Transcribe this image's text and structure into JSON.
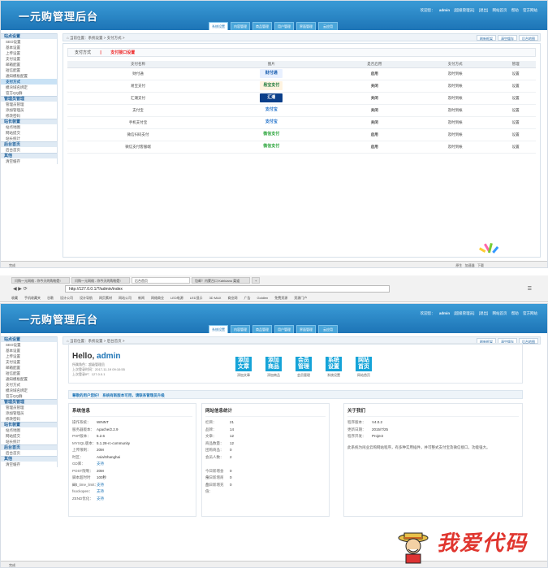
{
  "shot1": {
    "logo": "一元购管理后台",
    "topbar": [
      "欢迎您：",
      "admin",
      "[超级管理员]",
      "[退出]",
      "网站首页",
      "帮助",
      "官方网站"
    ],
    "tabs": [
      "系统设置",
      "内容管理",
      "商品管理",
      "用户管理",
      "界面管理",
      "云应用"
    ],
    "active_tab": "系统设置",
    "breadcrumb": "当前位置：系统设置 > 支付方式 >",
    "crumb_buttons": [
      "刷新框架",
      "清空缓存",
      "后台地图"
    ],
    "sidebar": [
      {
        "group": "站点设置",
        "items": [
          "SEO设置",
          "基本设置",
          "上传设置",
          "支付设置",
          "邮箱配置",
          "短信配置",
          "通知模板配置",
          "支付方式",
          "模块域名绑定",
          "官方QQ群"
        ]
      },
      {
        "group": "管理员管理",
        "items": [
          "管理员管理",
          "添加管理员",
          "修改密码"
        ]
      },
      {
        "group": "站长装置",
        "items": [
          "站点地图",
          "网站提交",
          "站长统计"
        ]
      },
      {
        "group": "后台首页",
        "items": [
          "后台首页"
        ]
      },
      {
        "group": "其他",
        "items": [
          "清空缓存"
        ]
      }
    ],
    "selected_sidebar": "支付方式",
    "panel_title": "支付方式",
    "panel_sub": "支付接口设置",
    "columns": [
      "支付名称",
      "图片",
      "是否启用",
      "支付方式",
      "管理"
    ],
    "rows": [
      {
        "name": "财付通",
        "logo": "财付通",
        "status": "启用",
        "method": "及时到帐",
        "op": "设置"
      },
      {
        "name": "易宝支付",
        "logo": "易宝支付",
        "status": "关闭",
        "method": "及时到帐",
        "op": "设置"
      },
      {
        "name": "汇潮支付",
        "logo": "汇潮",
        "status": "关闭",
        "method": "及时到帐",
        "op": "设置"
      },
      {
        "name": "支付宝",
        "logo": "支付宝",
        "status": "关闭",
        "method": "及时到帐",
        "op": "设置"
      },
      {
        "name": "手机支付宝",
        "logo": "支付宝",
        "status": "关闭",
        "method": "及时到帐",
        "op": "设置"
      },
      {
        "name": "微信扫码支付",
        "logo": "微信支付",
        "status": "启用",
        "method": "及时到帐",
        "op": "设置"
      },
      {
        "name": "微信支付客服端",
        "logo": "微信支付",
        "status": "启用",
        "method": "及时到帐",
        "op": "设置"
      }
    ],
    "status": "完成",
    "statusbar_right": [
      "原生",
      "加速器",
      "下载"
    ]
  },
  "browser": {
    "tabs": [
      "闪购一元网络 - 你今天的购物是!",
      "闪购一元网络 - 你今天的购物是!",
      "后台首页",
      "包邮！内蒙古口 Kahlúanu 渠道",
      "+"
    ],
    "url": "http://127.0.0.1/?/admin/index",
    "bookmarks": [
      "收藏",
      "手机收藏夹",
      "谷歌",
      "设计公司",
      "设计导航",
      "网页素材",
      "网站公司",
      "新闻",
      "网络商业",
      "LED电源",
      "LED显示",
      "3D MAX",
      "商业网",
      "广告",
      "Goldlen",
      "免费资源",
      "资源门户"
    ]
  },
  "shot2": {
    "hello": "Hello,",
    "user": "admin",
    "meta": [
      "所属角色：超级管理员",
      "上次登录时间：2017-11-19 09:10:55",
      "上次登录IP：127.0.0.1"
    ],
    "quick": [
      {
        "tile": "添加文章",
        "label": "添加文章"
      },
      {
        "tile": "添加商品",
        "label": "添加商品"
      },
      {
        "tile": "会员管理",
        "label": "会员管理"
      },
      {
        "tile": "系统设置",
        "label": "系统设置"
      },
      {
        "tile": "网站首页",
        "label": "网站首页"
      }
    ],
    "notice": "尊敬的用户您好！ 系统有新版本可用，请联系管理员升级",
    "sys_title": "系统信息",
    "sys": [
      {
        "k": "操作系统：",
        "v": "WINNT"
      },
      {
        "k": "服务器版本：",
        "v": "Apache/2.2.9"
      },
      {
        "k": "PHP版本：",
        "v": "5.2.6"
      },
      {
        "k": "MYSQL版本：",
        "v": "5.1.28-rc-community"
      },
      {
        "k": "上传限制：",
        "v": "20M"
      },
      {
        "k": "时区：",
        "v": "Asia/Shanghai"
      },
      {
        "k": "GD库：",
        "v": "支持"
      },
      {
        "k": "POST限制：",
        "v": "20M"
      },
      {
        "k": "脚本超时时间：",
        "v": "100秒"
      },
      {
        "k": "set_time_limit：",
        "v": "支持"
      },
      {
        "k": "fsockopen：",
        "v": "支持"
      },
      {
        "k": "ZEND优化：",
        "v": "支持"
      }
    ],
    "stat_title": "网站信息统计",
    "stats": [
      {
        "k": "栏目：",
        "v": "21"
      },
      {
        "k": "品牌：",
        "v": "14"
      },
      {
        "k": "文章：",
        "v": "12"
      },
      {
        "k": "商品数量：",
        "v": "12"
      },
      {
        "k": "团购商品：",
        "v": "0"
      },
      {
        "k": "会员人数：",
        "v": "2"
      },
      {
        "k": "",
        "v": ""
      },
      {
        "k": "今日新增会员：",
        "v": "0"
      },
      {
        "k": "今日新增商品：",
        "v": "0"
      },
      {
        "k": "今日新增充值：",
        "v": "0"
      }
    ],
    "about_title": "关于我们",
    "about": [
      {
        "k": "程序版本：",
        "v": "V4.0.2"
      },
      {
        "k": "更新日期：",
        "v": "2015/7/25"
      },
      {
        "k": "程序开发：",
        "v": "Project"
      }
    ],
    "about_text": "此系统为闲业云购网站程序，有多种实用插件，并可整式支付宝及微信接口，功能强大。",
    "watermark": "我爱代码"
  }
}
